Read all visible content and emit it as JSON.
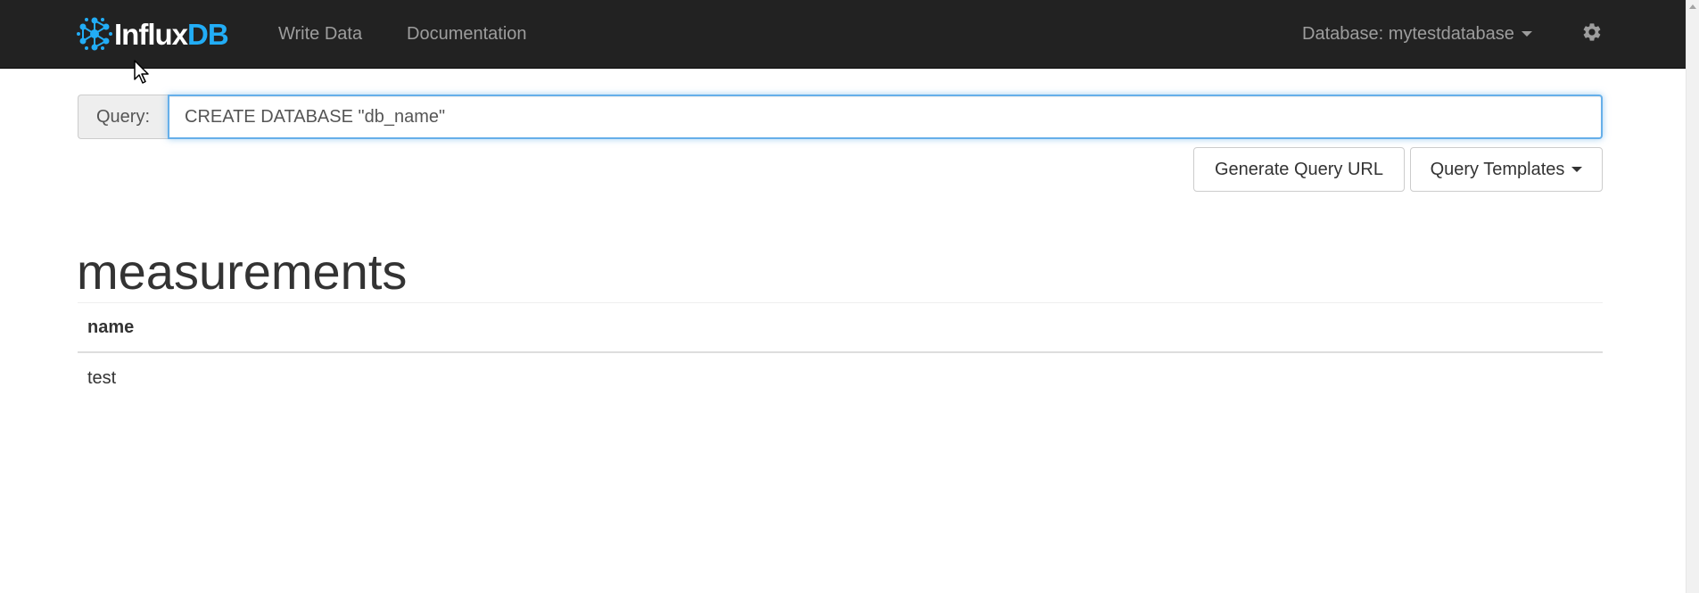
{
  "navbar": {
    "brand": {
      "part1": "Influx",
      "part2": "DB"
    },
    "links": [
      {
        "label": "Write Data"
      },
      {
        "label": "Documentation"
      }
    ],
    "database_dropdown": {
      "label": "Database: mytestdatabase"
    },
    "settings_icon": "gear-icon"
  },
  "query": {
    "addon_label": "Query:",
    "value": "CREATE DATABASE \"db_name\""
  },
  "buttons": {
    "generate_url": "Generate Query URL",
    "templates": "Query Templates"
  },
  "results": {
    "title": "measurements",
    "columns": [
      "name"
    ],
    "rows": [
      [
        "test"
      ]
    ]
  },
  "colors": {
    "navbar_bg": "#222222",
    "nav_text": "#9d9d9d",
    "brand_accent": "#22adf6",
    "input_focus": "#66afe9"
  }
}
